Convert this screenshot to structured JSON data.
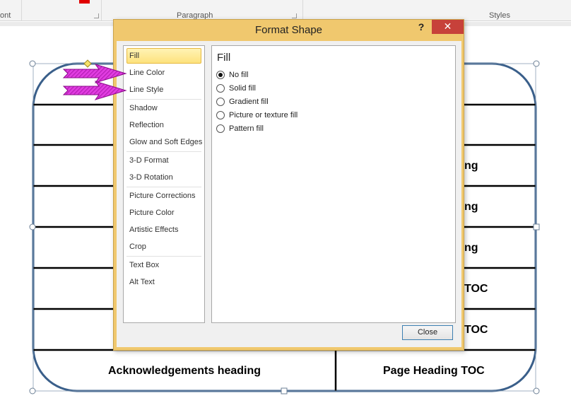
{
  "ribbon": {
    "left_group_label": "ont",
    "paragraph_label": "Paragraph",
    "styles_label": "Styles"
  },
  "document": {
    "row_labels_right_partial": [
      "ng",
      "ng",
      "ng",
      "TOC",
      "TOC"
    ],
    "bottom_left": "Acknowledgements heading",
    "bottom_right": "Page Heading TOC"
  },
  "dialog": {
    "title": "Format Shape",
    "help_label": "?",
    "close_glyph": "✕",
    "nav_items": [
      "Fill",
      "Line Color",
      "Line Style",
      "Shadow",
      "Reflection",
      "Glow and Soft Edges",
      "3-D Format",
      "3-D Rotation",
      "Picture Corrections",
      "Picture Color",
      "Artistic Effects",
      "Crop",
      "Text Box",
      "Alt Text"
    ],
    "selected_item": "Fill",
    "panel_title": "Fill",
    "fill_options": [
      "No fill",
      "Solid fill",
      "Gradient fill",
      "Picture or texture fill",
      "Pattern fill"
    ],
    "selected_fill": "No fill",
    "close_button": "Close"
  },
  "colors": {
    "dialog_frame": "#f0c86e",
    "shape_outline": "#3a5f8a",
    "arrow": "#cc22cc",
    "close_x_bg": "#c7413a"
  },
  "icons": {
    "annotation_arrows": "magenta-right-arrow"
  }
}
